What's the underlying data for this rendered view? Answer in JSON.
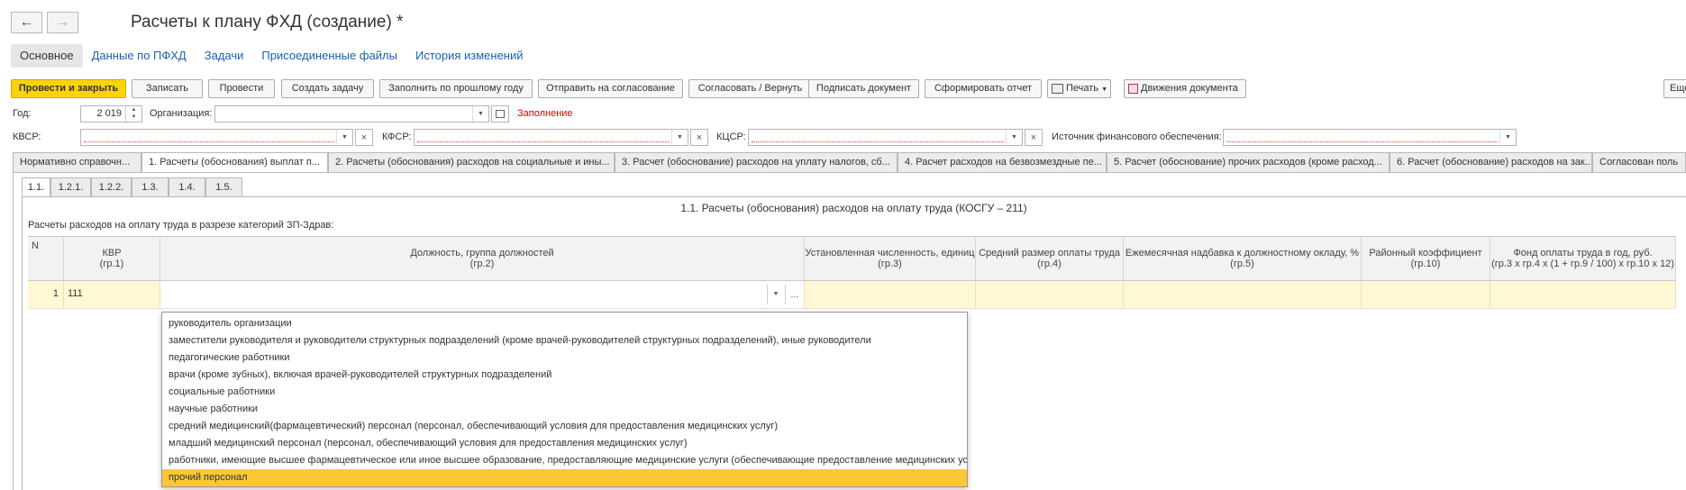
{
  "window": {
    "title": "Расчеты к плану ФХД (создание) *"
  },
  "nav": {
    "back_icon": "arrow-left-icon",
    "forward_icon": "arrow-right-icon"
  },
  "section_tabs": [
    {
      "label": "Основное"
    },
    {
      "label": "Данные по ПФХД"
    },
    {
      "label": "Задачи"
    },
    {
      "label": "Присоединенные файлы"
    },
    {
      "label": "История изменений"
    }
  ],
  "toolbar": {
    "post_close": "Провести и закрыть",
    "write": "Записать",
    "post": "Провести",
    "create_task": "Создать задачу",
    "fill_prev_year": "Заполнить по прошлому году",
    "send_approval": "Отправить на согласование",
    "approve_return": "Согласовать / Вернуть",
    "sign_doc": "Подписать документ",
    "make_report": "Сформировать отчет",
    "print": "Печать",
    "doc_moves": "Движения документа",
    "more": "Еще"
  },
  "form": {
    "year_label": "Год:",
    "year_value": "2 019",
    "org_label": "Организация:",
    "fill_status": "Заполнение",
    "kvsr_label": "КВСР:",
    "kfsr_label": "КФСР:",
    "kcsr_label": "КЦСР:",
    "source_label": "Источник финансового обеспечения:"
  },
  "main_tabs": [
    {
      "label": "Нормативно справочн..."
    },
    {
      "label": "1. Расчеты (обоснования) выплат п..."
    },
    {
      "label": "2. Расчеты (обоснования) расходов на социальные и ины..."
    },
    {
      "label": "3. Расчет (обоснование) расходов на уплату налогов, сб..."
    },
    {
      "label": "4. Расчет расходов на безвозмездные пе..."
    },
    {
      "label": "5. Расчет (обоснование) прочих расходов (кроме расход..."
    },
    {
      "label": "6. Расчет (обоснование) расходов на зак..."
    },
    {
      "label": "Согласован поль"
    }
  ],
  "sub_tabs": [
    {
      "label": "1.1."
    },
    {
      "label": "1.2.1."
    },
    {
      "label": "1.2.2."
    },
    {
      "label": "1.3."
    },
    {
      "label": "1.4."
    },
    {
      "label": "1.5."
    }
  ],
  "section_title": "1.1. Расчеты (обоснования) расходов на оплату труда (КОСГУ – 211)",
  "section_subtitle": "Расчеты расходов на оплату труда в разрезе категорий ЗП-Здрав:",
  "table": {
    "columns": [
      {
        "line1": "N",
        "line2": ""
      },
      {
        "line1": "КВР",
        "line2": "(гр.1)"
      },
      {
        "line1": "Должность, группа должностей",
        "line2": "(гр.2)"
      },
      {
        "line1": "Установленная численность, единиц",
        "line2": "(гр.3)"
      },
      {
        "line1": "Средний размер оплаты труда",
        "line2": "(гр.4)"
      },
      {
        "line1": "Ежемесячная надбавка к должностному окладу, %",
        "line2": "(гр.5)"
      },
      {
        "line1": "Районный коэффициент",
        "line2": "(гр.10)"
      },
      {
        "line1": "Фонд оплаты труда в год, руб.",
        "line2": "(гр.3 х гр.4 х (1 + гр.9 / 100) х гр.10 х 12)"
      }
    ],
    "rows": [
      {
        "n": "1",
        "kvr": "111",
        "position": "",
        "count": "",
        "avg_pay": "",
        "bonus": "",
        "region_coef": "",
        "fund": ""
      }
    ],
    "select_button": "..."
  },
  "dropdown": {
    "items": [
      "руководитель организации",
      "заместители руководителя и руководители структурных подразделений (кроме врачей-руководителей структурных подразделений), иные руководители",
      "педагогические работники",
      "врачи (кроме зубных), включая врачей-руководителей структурных подразделений",
      "социальные работники",
      "научные работники",
      "средний медицинский(фармацевтический) персонал (персонал, обеспечивающий условия для предоставления медицинских услуг)",
      "младший медицинский персонал (персонал, обеспечивающий условия для предоставления медицинских услуг)",
      "работники, имеющие высшее фармацевтическое или иное высшее образование, предоставляющие медицинские услуги (обеспечивающие предоставление медицинских услуг)",
      "прочий персонал"
    ],
    "selected_index": 9
  },
  "colors": {
    "accent": "#fbd30a",
    "link": "#1a5fb4",
    "row_highlight": "#fff8d5",
    "dropdown_selected": "#fbc737",
    "status_red": "#e00000"
  }
}
